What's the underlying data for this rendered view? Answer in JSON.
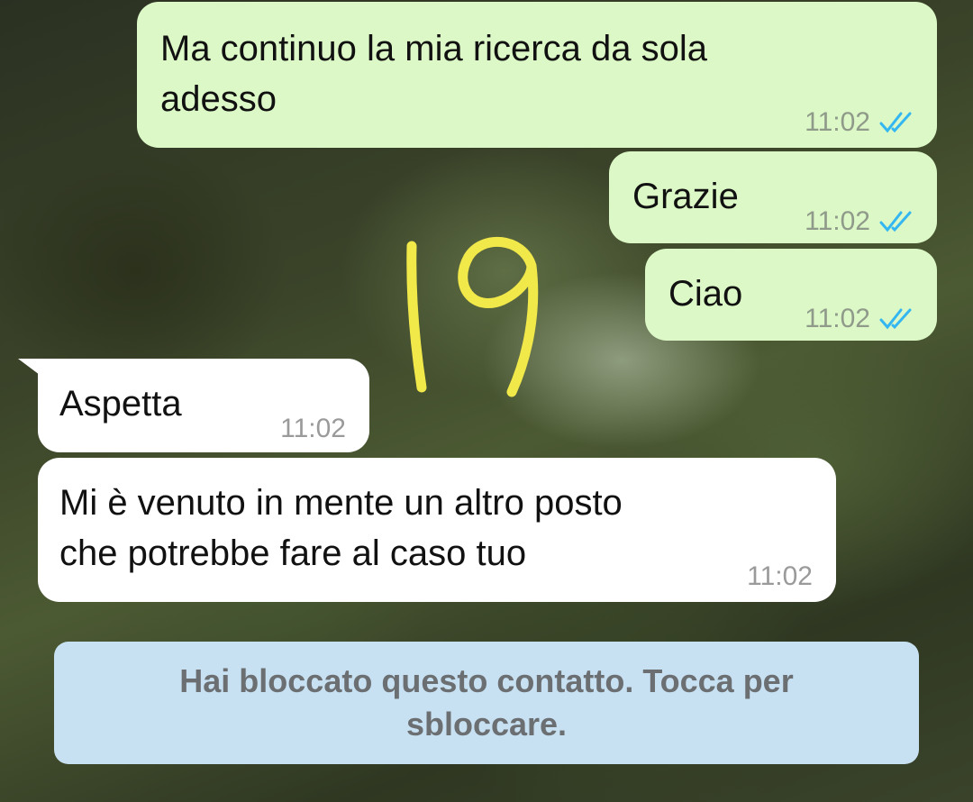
{
  "messages": [
    {
      "text": "Ma continuo la mia ricerca da sola\nadesso",
      "time": "11:02",
      "direction": "outgoing",
      "status_icon": "double-check-read-icon"
    },
    {
      "text": "Grazie",
      "time": "11:02",
      "direction": "outgoing",
      "status_icon": "double-check-read-icon"
    },
    {
      "text": "Ciao",
      "time": "11:02",
      "direction": "outgoing",
      "status_icon": "double-check-read-icon"
    },
    {
      "text": "Aspetta",
      "time": "11:02",
      "direction": "incoming"
    },
    {
      "text": "Mi è venuto in mente un altro posto\nche potrebbe fare al caso tuo",
      "time": "11:02",
      "direction": "incoming"
    }
  ],
  "blocked_banner": {
    "text": "Hai bloccato questo contatto. Tocca per sbloccare."
  },
  "overlay_annotation": {
    "text": "19",
    "color": "#f1e84a"
  },
  "colors": {
    "outgoing_bubble": "#dcf8c6",
    "incoming_bubble": "#ffffff",
    "read_ticks": "#34b7f1",
    "banner": "#c7e1f3"
  }
}
